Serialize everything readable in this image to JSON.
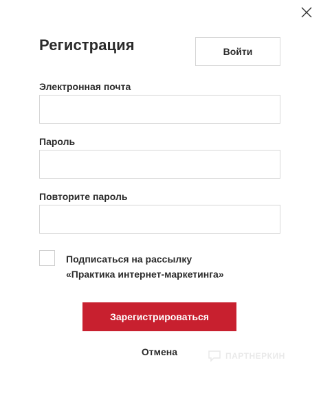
{
  "modal": {
    "title": "Регистрация",
    "login_label": "Войти",
    "close_icon": "close-icon"
  },
  "form": {
    "email": {
      "label": "Электронная почта",
      "value": "",
      "placeholder": ""
    },
    "password": {
      "label": "Пароль",
      "value": "",
      "placeholder": ""
    },
    "password_repeat": {
      "label": "Повторите пароль",
      "value": "",
      "placeholder": ""
    },
    "subscribe": {
      "checked": false,
      "label_line1": "Подписаться на рассылку",
      "label_line2": "«Практика интернет-маркетинга»"
    },
    "submit_label": "Зарегистрироваться",
    "cancel_label": "Отмена"
  },
  "watermark": {
    "text": "ПАРТНЕРКИН",
    "icon": "chat-bubble-icon"
  },
  "colors": {
    "accent": "#c8202f",
    "border": "#d6d6d6",
    "text": "#2b2b2b",
    "background": "#ffffff"
  }
}
